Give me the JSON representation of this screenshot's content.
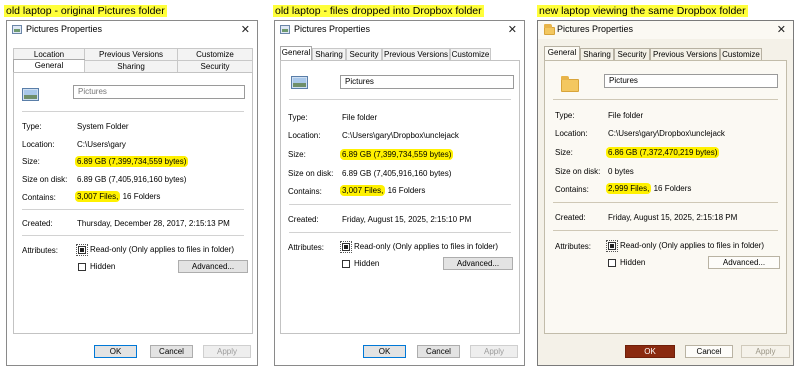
{
  "captions": [
    "old laptop - original Pictures folder",
    "old laptop - files dropped into Dropbox folder",
    "new laptop viewing the same Dropbox folder"
  ],
  "colors": {
    "highlight": "#fff100",
    "caption_highlight": "#ffff3a",
    "ok_accent_w11": "#8a2a10"
  },
  "dialogs": [
    {
      "title": "Pictures Properties",
      "tabs_row1": [
        "Location",
        "Previous Versions",
        "Customize"
      ],
      "tabs_row2": [
        "General",
        "Sharing",
        "Security"
      ],
      "selected_tab": "General",
      "name_value": "Pictures",
      "labels": {
        "type": "Type:",
        "location": "Location:",
        "size": "Size:",
        "size_on_disk": "Size on disk:",
        "contains": "Contains:",
        "created": "Created:",
        "attributes": "Attributes:"
      },
      "type": "System Folder",
      "location": "C:\\Users\\gary",
      "size": "6.89 GB (7,399,734,559 bytes)",
      "size_on_disk": "6.89 GB (7,405,916,160 bytes)",
      "contains_files": "3,007 Files,",
      "contains_folders": "16 Folders",
      "created": "Thursday, December 28, 2017, 2:15:13 PM",
      "readonly_label": "Read-only (Only applies to files in folder)",
      "hidden_label": "Hidden",
      "advanced_label": "Advanced...",
      "buttons": {
        "ok": "OK",
        "cancel": "Cancel",
        "apply": "Apply"
      }
    },
    {
      "title": "Pictures Properties",
      "tabs": [
        "General",
        "Sharing",
        "Security",
        "Previous Versions",
        "Customize"
      ],
      "selected_tab": "General",
      "name_value": "Pictures",
      "labels": {
        "type": "Type:",
        "location": "Location:",
        "size": "Size:",
        "size_on_disk": "Size on disk:",
        "contains": "Contains:",
        "created": "Created:",
        "attributes": "Attributes:"
      },
      "type": "File folder",
      "location": "C:\\Users\\gary\\Dropbox\\unclejack",
      "size": "6.89 GB (7,399,734,559 bytes)",
      "size_on_disk": "6.89 GB (7,405,916,160 bytes)",
      "contains_files": "3,007 Files,",
      "contains_folders": "16 Folders",
      "created": "Friday, August 15, 2025, 2:15:10 PM",
      "readonly_label": "Read-only (Only applies to files in folder)",
      "hidden_label": "Hidden",
      "advanced_label": "Advanced...",
      "buttons": {
        "ok": "OK",
        "cancel": "Cancel",
        "apply": "Apply"
      }
    },
    {
      "title": "Pictures Properties",
      "tabs": [
        "General",
        "Sharing",
        "Security",
        "Previous Versions",
        "Customize"
      ],
      "selected_tab": "General",
      "name_value": "Pictures",
      "labels": {
        "type": "Type:",
        "location": "Location:",
        "size": "Size:",
        "size_on_disk": "Size on disk:",
        "contains": "Contains:",
        "created": "Created:",
        "attributes": "Attributes:"
      },
      "type": "File folder",
      "location": "C:\\Users\\gary\\Dropbox\\unclejack",
      "size": "6.86 GB (7,372,470,219 bytes)",
      "size_on_disk": "0 bytes",
      "contains_files": "2,999 Files,",
      "contains_folders": "16 Folders",
      "created": "Friday, August 15, 2025, 2:15:18 PM",
      "readonly_label": "Read-only (Only applies to files in folder)",
      "hidden_label": "Hidden",
      "advanced_label": "Advanced...",
      "buttons": {
        "ok": "OK",
        "cancel": "Cancel",
        "apply": "Apply"
      }
    }
  ]
}
